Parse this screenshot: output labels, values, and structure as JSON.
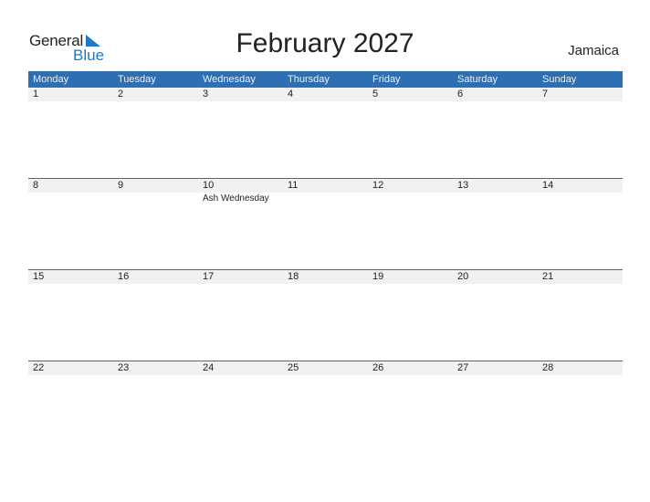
{
  "logo": {
    "line1": "General",
    "line2": "Blue"
  },
  "title": "February 2027",
  "country": "Jamaica",
  "colors": {
    "header_bg": "#2e6fb3",
    "accent": "#1f78c8",
    "day_row_bg": "#f1f1f1"
  },
  "weekdays": [
    "Monday",
    "Tuesday",
    "Wednesday",
    "Thursday",
    "Friday",
    "Saturday",
    "Sunday"
  ],
  "weeks": [
    {
      "days": [
        "1",
        "2",
        "3",
        "4",
        "5",
        "6",
        "7"
      ],
      "events": [
        "",
        "",
        "",
        "",
        "",
        "",
        ""
      ]
    },
    {
      "days": [
        "8",
        "9",
        "10",
        "11",
        "12",
        "13",
        "14"
      ],
      "events": [
        "",
        "",
        "Ash Wednesday",
        "",
        "",
        "",
        ""
      ]
    },
    {
      "days": [
        "15",
        "16",
        "17",
        "18",
        "19",
        "20",
        "21"
      ],
      "events": [
        "",
        "",
        "",
        "",
        "",
        "",
        ""
      ]
    },
    {
      "days": [
        "22",
        "23",
        "24",
        "25",
        "26",
        "27",
        "28"
      ],
      "events": [
        "",
        "",
        "",
        "",
        "",
        "",
        ""
      ]
    }
  ]
}
